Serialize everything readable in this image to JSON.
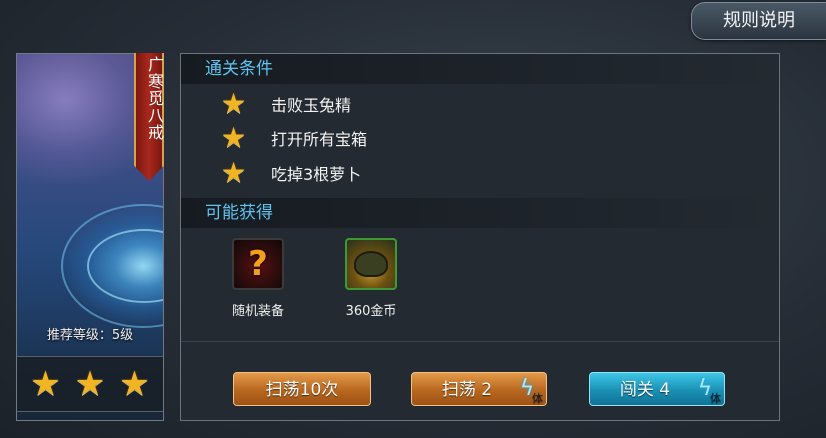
{
  "header": {
    "rules_label": "规则说明"
  },
  "level_card": {
    "name": "广寒觅八戒",
    "recommended_level": "推荐等级：5级",
    "stars_earned": 3,
    "stars_total": 3
  },
  "conditions": {
    "title": "通关条件",
    "items": [
      {
        "label": "击败玉兔精",
        "icon": "star-icon"
      },
      {
        "label": "打开所有宝箱",
        "icon": "star-icon"
      },
      {
        "label": "吃掉3根萝卜",
        "icon": "star-icon"
      }
    ]
  },
  "rewards": {
    "title": "可能获得",
    "items": [
      {
        "label": "随机装备",
        "icon": "random-equipment-icon",
        "glyph": "?"
      },
      {
        "label": "360金币",
        "icon": "gold-coins-icon"
      }
    ]
  },
  "actions": {
    "sweep10": {
      "label": "扫荡10次"
    },
    "sweep": {
      "label": "扫荡 2",
      "energy_unit": "体"
    },
    "challenge": {
      "label": "闯关 4",
      "energy_unit": "体"
    }
  },
  "colors": {
    "star": "#f1b422",
    "section_title": "#5fc4ef",
    "orange_button": "#c9782e",
    "blue_button": "#1c9cc1"
  }
}
